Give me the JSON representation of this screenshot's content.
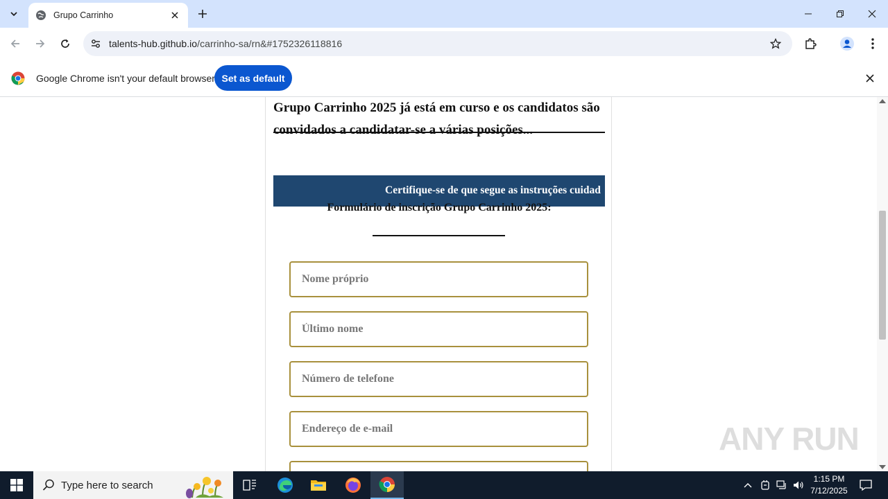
{
  "browser": {
    "tab_title": "Grupo Carrinho",
    "url_host": "talents-hub.github.io",
    "url_path": "/carrinho-sa/rn&#1752326118816",
    "infobar_message": "Google Chrome isn't your default browser",
    "infobar_button": "Set as default"
  },
  "page": {
    "headline": "Grupo Carrinho 2025 já está em curso e os candidatos são convidados a candidatar-se a várias posições...",
    "banner_text": "Certifique-se de que segue as instruções cuidad",
    "form_title": "Formulário de inscrição Grupo Carrinho 2025:",
    "fields": [
      {
        "placeholder": "Nome próprio"
      },
      {
        "placeholder": "Último nome"
      },
      {
        "placeholder": "Número de telefone"
      },
      {
        "placeholder": "Endereço de e-mail"
      }
    ]
  },
  "watermark": "ANY RUN",
  "taskbar": {
    "search_placeholder": "Type here to search",
    "time": "1:15 PM",
    "date": "7/12/2025"
  },
  "colors": {
    "tabstrip": "#d3e3fd",
    "banner": "#1f4770",
    "field_border": "#a8903c",
    "primary_button": "#0b57d0",
    "taskbar": "#101c2c"
  }
}
